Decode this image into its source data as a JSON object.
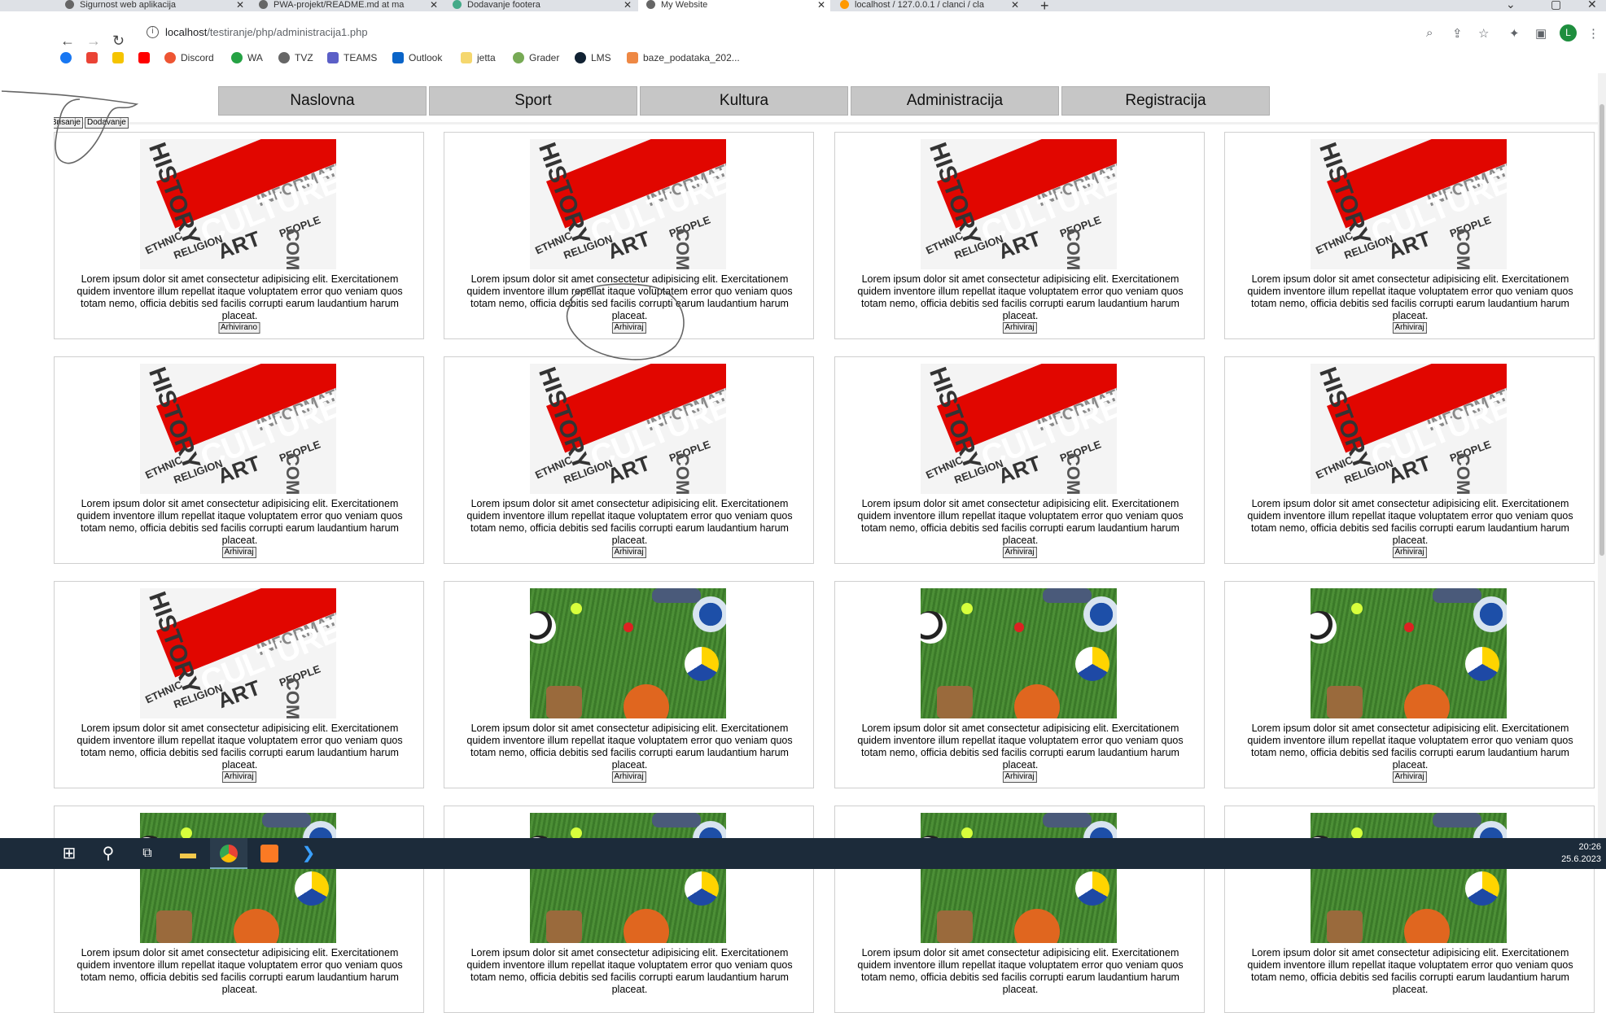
{
  "browser": {
    "tabs": [
      {
        "title": "Sigurnost web aplikacija",
        "active": false
      },
      {
        "title": "PWA-projekt/README.md at ma",
        "active": false
      },
      {
        "title": "Dodavanje footera",
        "active": false
      },
      {
        "title": "My Website",
        "active": true
      },
      {
        "title": "localhost / 127.0.0.1 / clanci / cla",
        "active": false
      }
    ],
    "url_host": "localhost",
    "url_path": "/testiranje/php/administracija1.php",
    "profile_initial": "L",
    "bookmarks": [
      "Discord",
      "WA",
      "TVZ",
      "TEAMS",
      "Outlook",
      "jetta",
      "Grader",
      "LMS",
      "baze_podataka_202..."
    ]
  },
  "nav": {
    "items": [
      "Naslovna",
      "Sport",
      "Kultura",
      "Administracija",
      "Registracija"
    ]
  },
  "admin": {
    "delete_label": "Brisanje",
    "add_label": "Dodavanje"
  },
  "cards": {
    "text": "Lorem ipsum dolor sit amet consectetur adipisicing elit. Exercitationem quidem inventore illum repellat itaque voluptatem error quo veniam quos totam nemo, officia debitis sed facilis corrupti earum laudantium harum placeat.",
    "archived_label": "Arhivirano",
    "archive_label": "Arhiviraj",
    "culture_image": {
      "title": "CULTURE",
      "words": [
        "HISTORY",
        "ART",
        "ETHNIC",
        "INFORMATION",
        "PEOPLE",
        "COMMUNITY",
        "RELIGION"
      ]
    },
    "items": [
      {
        "image": "culture",
        "button": "Arhivirano"
      },
      {
        "image": "culture",
        "button": "Arhiviraj"
      },
      {
        "image": "culture",
        "button": "Arhiviraj"
      },
      {
        "image": "culture",
        "button": "Arhiviraj"
      },
      {
        "image": "culture",
        "button": "Arhiviraj"
      },
      {
        "image": "culture",
        "button": "Arhiviraj"
      },
      {
        "image": "culture",
        "button": "Arhiviraj"
      },
      {
        "image": "culture",
        "button": "Arhiviraj"
      },
      {
        "image": "culture",
        "button": "Arhiviraj"
      },
      {
        "image": "sports",
        "button": "Arhiviraj"
      },
      {
        "image": "sports",
        "button": "Arhiviraj"
      },
      {
        "image": "sports",
        "button": "Arhiviraj"
      },
      {
        "image": "sports",
        "button": ""
      },
      {
        "image": "sports",
        "button": ""
      },
      {
        "image": "sports",
        "button": ""
      },
      {
        "image": "sports",
        "button": ""
      }
    ]
  },
  "taskbar": {
    "time": "20:26",
    "date": "25.6.2023"
  }
}
